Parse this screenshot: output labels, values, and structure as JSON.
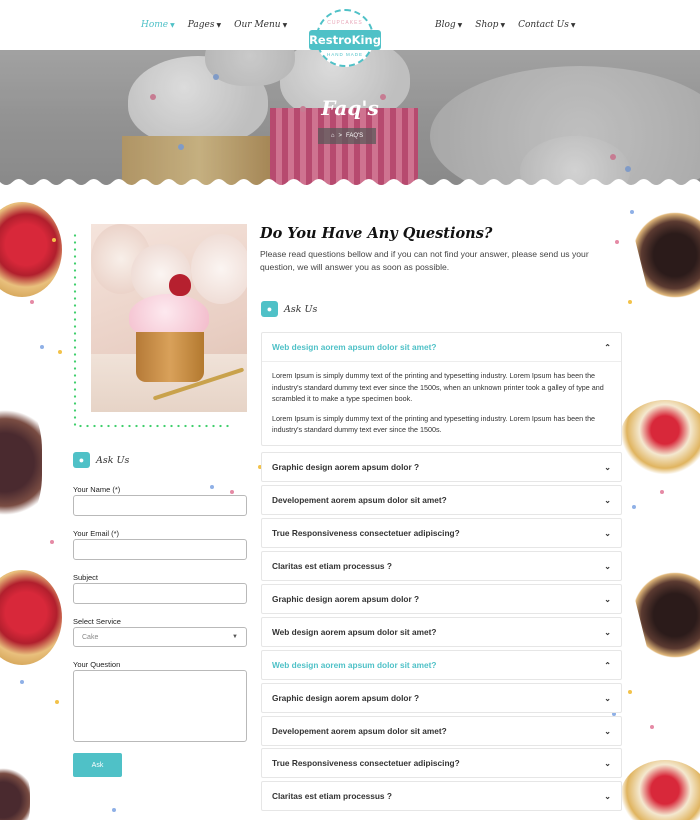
{
  "nav": {
    "left": [
      {
        "label": "Home",
        "active": true
      },
      {
        "label": "Pages",
        "active": false
      },
      {
        "label": "Our Menu",
        "active": false
      }
    ],
    "right": [
      {
        "label": "Blog",
        "active": false
      },
      {
        "label": "Shop",
        "active": false
      },
      {
        "label": "Contact Us",
        "active": false
      }
    ]
  },
  "logo": {
    "name": "RestroKing",
    "tagline_top": "CUPCAKES",
    "tagline_bottom": "HAND MADE"
  },
  "banner": {
    "title": "Faq's",
    "breadcrumb": {
      "home_icon": "home-icon",
      "separator": ">",
      "current": "FAQ'S"
    }
  },
  "contact_form": {
    "heading": "Ask Us",
    "name_label": "Your Name (*)",
    "email_label": "Your Email (*)",
    "subject_label": "Subject",
    "service_label": "Select Service",
    "service_value": "Cake",
    "question_label": "Your Question",
    "submit_label": "Ask"
  },
  "faq": {
    "title": "Do You Have Any Questions?",
    "intro": "Please read questions bellow and if you can not find your answer, please send us your question, we will answer you as soon as possible.",
    "subheading": "Ask Us",
    "items": [
      {
        "question": "Web design aorem apsum dolor sit amet?",
        "open": true,
        "answer": [
          "Lorem Ipsum is simply dummy text of the printing and typesetting industry. Lorem Ipsum has been the industry's standard dummy text ever since the 1500s, when an unknown printer took a galley of type and scrambled it to make a type specimen book.",
          "Lorem Ipsum is simply dummy text of the printing and typesetting industry. Lorem Ipsum has been the industry's standard dummy text ever since the 1500s."
        ]
      },
      {
        "question": "Graphic design aorem apsum dolor ?",
        "open": false
      },
      {
        "question": "Developement aorem apsum dolor sit amet?",
        "open": false
      },
      {
        "question": "True Responsiveness consectetuer adipiscing?",
        "open": false
      },
      {
        "question": "Claritas est etiam processus ?",
        "open": false
      },
      {
        "question": "Graphic design aorem apsum dolor ?",
        "open": false
      },
      {
        "question": "Web design aorem apsum dolor sit amet?",
        "open": false
      },
      {
        "question": "Web design aorem apsum dolor sit amet?",
        "open": true
      },
      {
        "question": "Graphic design aorem apsum dolor ?",
        "open": false
      },
      {
        "question": "Developement aorem apsum dolor sit amet?",
        "open": false
      },
      {
        "question": "True Responsiveness consectetuer adipiscing?",
        "open": false
      },
      {
        "question": "Claritas est etiam processus ?",
        "open": false
      }
    ]
  },
  "colors": {
    "accent": "#4fc1c7",
    "dots": "#3fcf6c"
  }
}
